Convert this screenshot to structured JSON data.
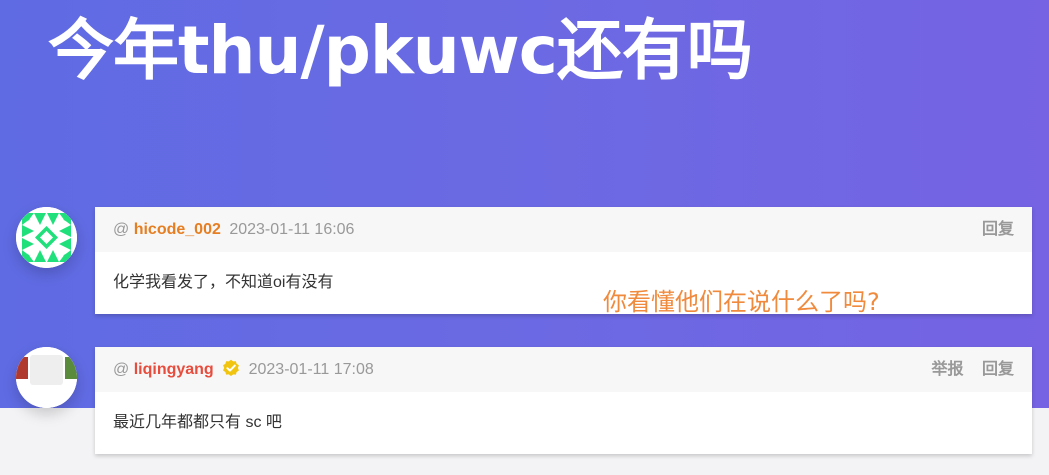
{
  "page": {
    "title": "今年thu/pkuwc还有吗"
  },
  "comments": [
    {
      "at": "@",
      "username": "hicode_002",
      "timestamp": "2023-01-11 16:06",
      "content": "化学我看发了，不知道oi有没有",
      "actions": [
        "回复"
      ],
      "avatar_icon": "identicon-avatar",
      "username_color": "#e67e22"
    },
    {
      "at": "@",
      "username": "liqingyang",
      "timestamp": "2023-01-11 17:08",
      "content": "最近几年都都只有 sc 吧",
      "actions": [
        "举报",
        "回复"
      ],
      "avatar_icon": "user-avatar",
      "verified_icon": "verified-badge-icon",
      "username_color": "#e74c3c"
    }
  ],
  "overlay": {
    "annotation": "你看懂他们在说什么了吗?"
  },
  "colors": {
    "hero_gradient_start": "#5f6be3",
    "hero_gradient_end": "#7563e3",
    "annotation": "#f08a3c",
    "badge": "#f1c40f"
  }
}
